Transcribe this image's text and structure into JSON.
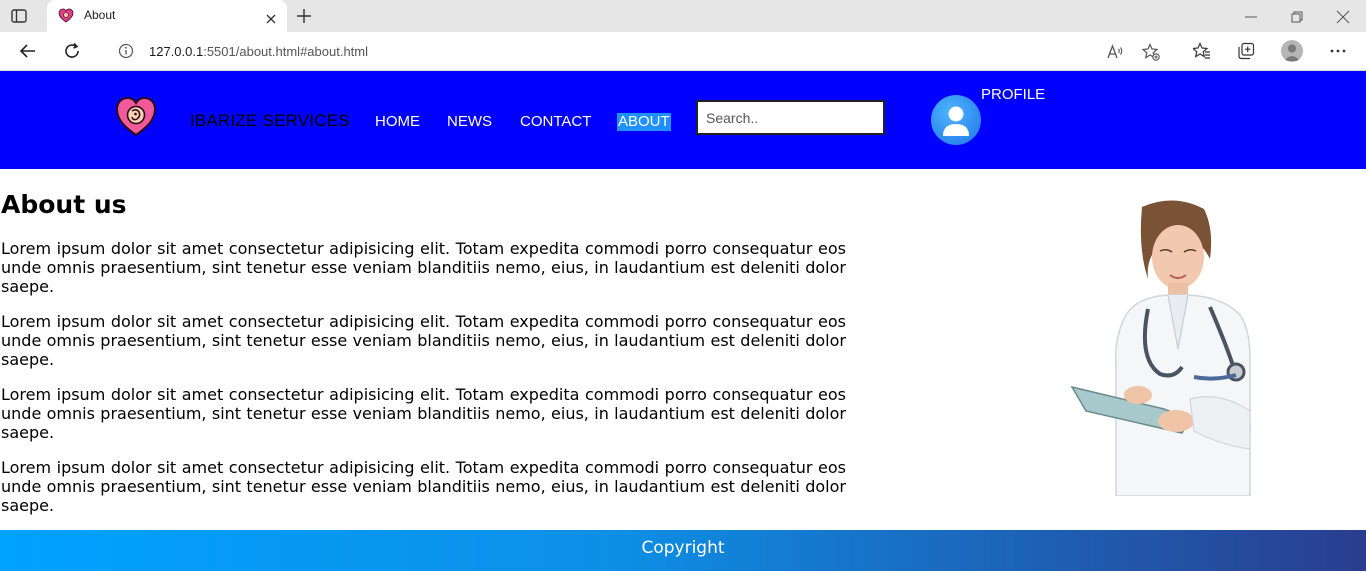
{
  "browser": {
    "tab_title": "About",
    "url_host": "127.0.0.1",
    "url_rest": ":5501/about.html#about.html",
    "icons": {
      "tab_actions": "tab-actions-icon",
      "favicon": "heart-logo-icon",
      "tab_close": "close-icon",
      "new_tab": "plus-icon",
      "back": "back-arrow-icon",
      "reload": "reload-icon",
      "site_info": "info-icon",
      "read_aloud": "read-aloud-icon",
      "add_favorite": "add-favorite-icon",
      "favorites": "favorites-icon",
      "collections": "collections-icon",
      "profile": "profile-icon",
      "more": "more-icon"
    }
  },
  "header": {
    "brand": "IBARIZE SERVICES",
    "nav": [
      {
        "label": "HOME"
      },
      {
        "label": "NEWS"
      },
      {
        "label": "CONTACT"
      },
      {
        "label": "ABOUT",
        "active": true
      }
    ],
    "search_placeholder": "Search..",
    "profile_label": "PROFILE",
    "colors": {
      "background": "#0000ff",
      "active_nav_bg": "#1e90ff"
    }
  },
  "main": {
    "title": "About us",
    "paragraphs": [
      "Lorem ipsum dolor sit amet consectetur adipisicing elit. Totam expedita commodi porro consequatur eos unde omnis praesentium, sint tenetur esse veniam blanditiis nemo, eius, in laudantium est deleniti dolor saepe.",
      "Lorem ipsum dolor sit amet consectetur adipisicing elit. Totam expedita commodi porro consequatur eos unde omnis praesentium, sint tenetur esse veniam blanditiis nemo, eius, in laudantium est deleniti dolor saepe.",
      "Lorem ipsum dolor sit amet consectetur adipisicing elit. Totam expedita commodi porro consequatur eos unde omnis praesentium, sint tenetur esse veniam blanditiis nemo, eius, in laudantium est deleniti dolor saepe.",
      "Lorem ipsum dolor sit amet consectetur adipisicing elit. Totam expedita commodi porro consequatur eos unde omnis praesentium, sint tenetur esse veniam blanditiis nemo, eius, in laudantium est deleniti dolor saepe."
    ]
  },
  "footer": {
    "text": "Copyright"
  }
}
